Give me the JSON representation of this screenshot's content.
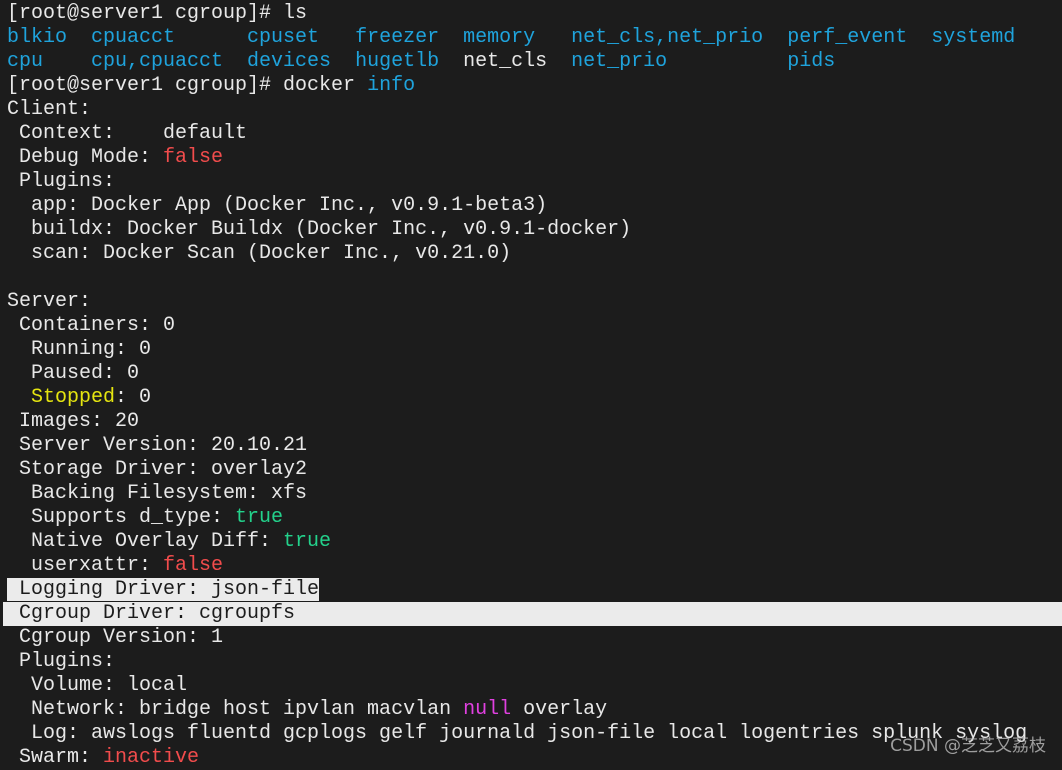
{
  "terminal": {
    "lines": [
      [
        {
          "t": "[root@server1 cgroup]# ls",
          "c": "white"
        }
      ],
      [
        {
          "t": "blkio  ",
          "c": "cyan"
        },
        {
          "t": "cpuacct      ",
          "c": "cyan"
        },
        {
          "t": "cpuset   ",
          "c": "cyan"
        },
        {
          "t": "freezer  ",
          "c": "cyan"
        },
        {
          "t": "memory   ",
          "c": "cyan"
        },
        {
          "t": "net_cls,net_prio  ",
          "c": "cyan"
        },
        {
          "t": "perf_event  ",
          "c": "cyan"
        },
        {
          "t": "systemd",
          "c": "cyan"
        }
      ],
      [
        {
          "t": "cpu    ",
          "c": "cyan"
        },
        {
          "t": "cpu,cpuacct  ",
          "c": "cyan"
        },
        {
          "t": "devices  ",
          "c": "cyan"
        },
        {
          "t": "hugetlb  ",
          "c": "cyan"
        },
        {
          "t": "net_cls  ",
          "c": "white"
        },
        {
          "t": "net_prio          ",
          "c": "cyan"
        },
        {
          "t": "pids",
          "c": "cyan"
        }
      ],
      [
        {
          "t": "[root@server1 cgroup]# docker ",
          "c": "white"
        },
        {
          "t": "info",
          "c": "cyan"
        }
      ],
      [
        {
          "t": "Client:",
          "c": "white"
        }
      ],
      [
        {
          "t": " Context:    default",
          "c": "white"
        }
      ],
      [
        {
          "t": " Debug Mode: ",
          "c": "white"
        },
        {
          "t": "false",
          "c": "red"
        }
      ],
      [
        {
          "t": " Plugins:",
          "c": "white"
        }
      ],
      [
        {
          "t": "  app: Docker App (Docker Inc., v0.9.1-beta3)",
          "c": "white"
        }
      ],
      [
        {
          "t": "  buildx: Docker Buildx (Docker Inc., v0.9.1-docker)",
          "c": "white"
        }
      ],
      [
        {
          "t": "  scan: Docker Scan (Docker Inc., v0.21.0)",
          "c": "white"
        }
      ],
      [
        {
          "t": "",
          "c": "white"
        }
      ],
      [
        {
          "t": "Server:",
          "c": "white"
        }
      ],
      [
        {
          "t": " Containers: 0",
          "c": "white"
        }
      ],
      [
        {
          "t": "  Running: 0",
          "c": "white"
        }
      ],
      [
        {
          "t": "  Paused: 0",
          "c": "white"
        }
      ],
      [
        {
          "t": "  ",
          "c": "white"
        },
        {
          "t": "Stopped",
          "c": "yellow"
        },
        {
          "t": ": 0",
          "c": "white"
        }
      ],
      [
        {
          "t": " Images: 20",
          "c": "white"
        }
      ],
      [
        {
          "t": " Server Version: 20.10.21",
          "c": "white"
        }
      ],
      [
        {
          "t": " Storage Driver: overlay2",
          "c": "white"
        }
      ],
      [
        {
          "t": "  Backing Filesystem: xfs",
          "c": "white"
        }
      ],
      [
        {
          "t": "  Supports d_type: ",
          "c": "white"
        },
        {
          "t": "true",
          "c": "green"
        }
      ],
      [
        {
          "t": "  Native Overlay Diff: ",
          "c": "white"
        },
        {
          "t": "true",
          "c": "green"
        }
      ],
      [
        {
          "t": "  userxattr: ",
          "c": "white"
        },
        {
          "t": "false",
          "c": "red"
        }
      ],
      [
        {
          "t": " Logging Driver: json-file",
          "c": "dark",
          "sel": true
        }
      ],
      [
        {
          "t": " Cgroup Driver: cgroupfs",
          "c": "dark",
          "selfull": true
        }
      ],
      [
        {
          "t": " Cgroup Version: 1",
          "c": "white"
        }
      ],
      [
        {
          "t": " Plugins:",
          "c": "white"
        }
      ],
      [
        {
          "t": "  Volume: local",
          "c": "white"
        }
      ],
      [
        {
          "t": "  Network: bridge host ipvlan macvlan ",
          "c": "white"
        },
        {
          "t": "null",
          "c": "magenta"
        },
        {
          "t": " overlay",
          "c": "white"
        }
      ],
      [
        {
          "t": "  Log: awslogs fluentd gcplogs gelf journald json-file local logentries splunk syslog",
          "c": "white"
        }
      ],
      [
        {
          "t": " Swarm: ",
          "c": "white"
        },
        {
          "t": "inactive",
          "c": "red"
        }
      ]
    ]
  },
  "watermark": "CSDN @芝芝又荔枝",
  "colors": {
    "background": "#1c1c1c",
    "cyan": "#1fa3dc",
    "red": "#f14c4c",
    "green": "#23d18b",
    "yellow": "#e5e510",
    "magenta": "#e040e0",
    "selection": "#ebebeb"
  }
}
